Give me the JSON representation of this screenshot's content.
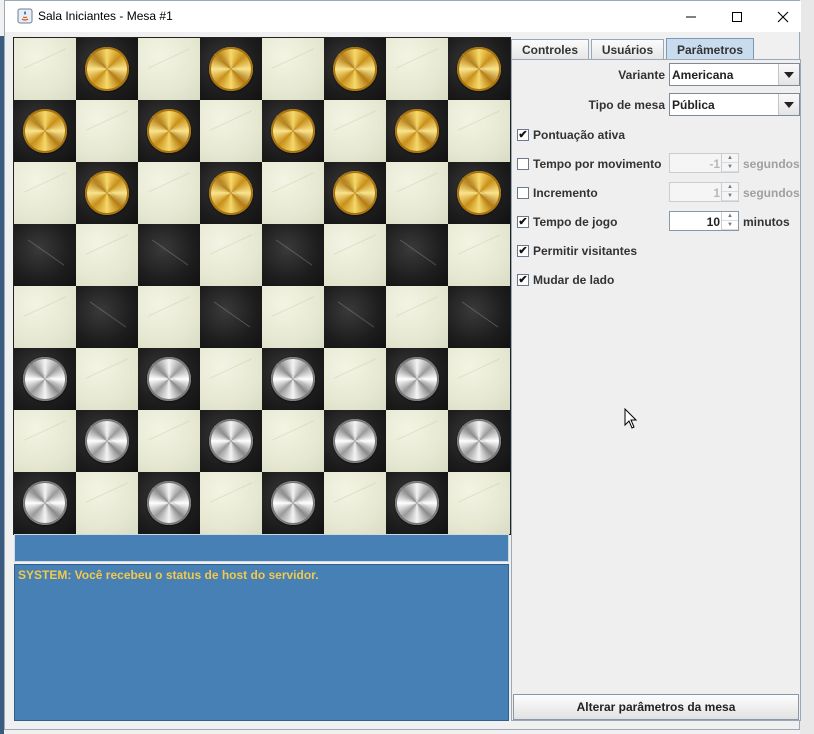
{
  "window": {
    "title": "Sala Iniciantes - Mesa #1"
  },
  "board": {
    "size": 8,
    "pieces": [
      "_g_g_g_g",
      "g_g_g_g_",
      "_g_g_g_g",
      "________",
      "________",
      "s_s_s_s_",
      "_s_s_s_s",
      "s_s_s_s_"
    ]
  },
  "chat": {
    "input_value": "",
    "messages": [
      "SYSTEM: Você recebeu o status de host do servidor."
    ]
  },
  "tabs": [
    {
      "label": "Controles",
      "active": false
    },
    {
      "label": "Usuários",
      "active": false
    },
    {
      "label": "Parâmetros",
      "active": true
    }
  ],
  "params": {
    "variant": {
      "label": "Variante",
      "value": "Americana"
    },
    "table_type": {
      "label": "Tipo de mesa",
      "value": "Pública"
    },
    "scoring": {
      "label": "Pontuação ativa",
      "checked": true
    },
    "move_time": {
      "label": "Tempo por movimento",
      "checked": false,
      "value": "-1",
      "unit": "segundos"
    },
    "increment": {
      "label": "Incremento",
      "checked": false,
      "value": "1",
      "unit": "segundos"
    },
    "game_time": {
      "label": "Tempo de jogo",
      "checked": true,
      "value": "10",
      "unit": "minutos"
    },
    "visitors": {
      "label": "Permitir visitantes",
      "checked": true
    },
    "switch_sides": {
      "label": "Mudar de lado",
      "checked": true
    },
    "apply_label": "Alterar parâmetros da mesa"
  },
  "colors": {
    "chat_bg": "#4680b5",
    "system_text": "#f2c94c",
    "tab_active": "#c8dcee"
  }
}
